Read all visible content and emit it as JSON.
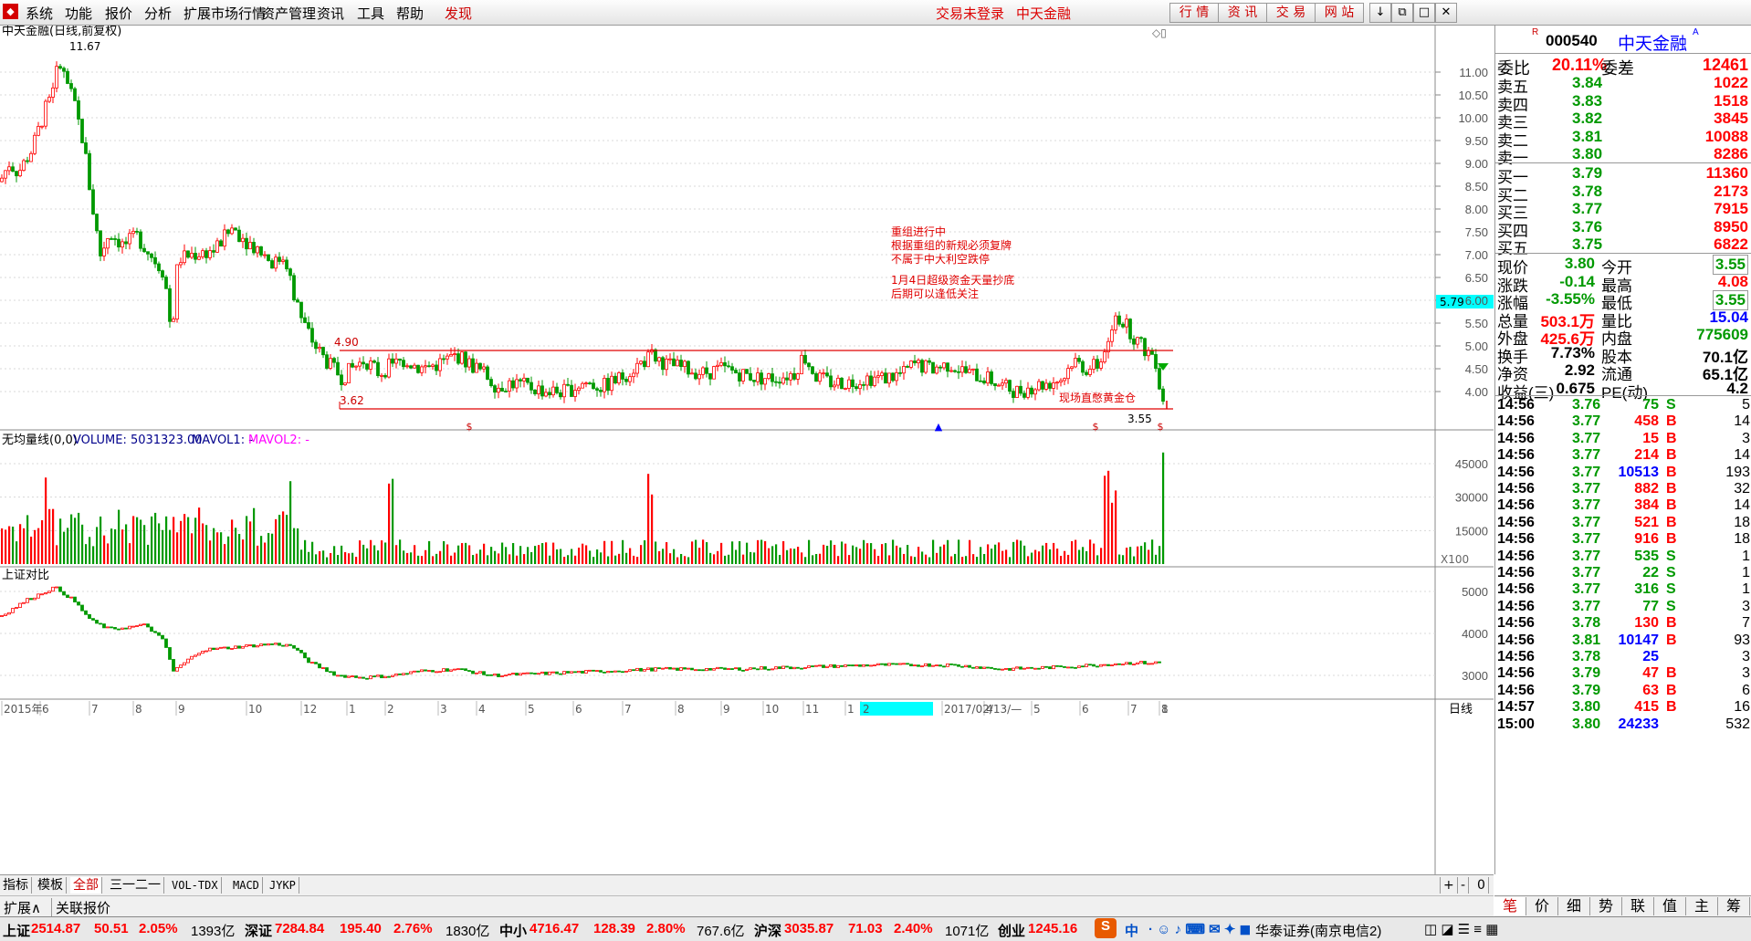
{
  "menu": [
    "系统",
    "功能",
    "报价",
    "分析",
    "扩展市场行情",
    "资产管理",
    "资讯",
    "工具",
    "帮助",
    "发现"
  ],
  "status_msg": "交易未登录",
  "status_app": "中天金融",
  "top_buttons": [
    "行 情",
    "资 讯",
    "交 易",
    "网 站"
  ],
  "window_buttons": [
    "↓",
    "⧉",
    "□",
    "✕"
  ],
  "chart": {
    "title": "中天金融(日线,前复权)",
    "max_label": "11.67",
    "price_ticks": [
      "11.00",
      "10.50",
      "10.00",
      "9.50",
      "9.00",
      "8.50",
      "8.00",
      "7.50",
      "7.00",
      "6.50",
      "6.00",
      "5.50",
      "5.00",
      "4.50",
      "4.00"
    ],
    "current_price_tag": "5.79",
    "line_490": "4.90",
    "line_362": "3.62",
    "min_label": "3.55",
    "annotation_lines": [
      "重组进行中",
      "根据重组的新规必须复牌",
      "不属于中大利空跌停",
      "1月4日超级资金天量抄底",
      "后期可以逢低关注"
    ],
    "note_bottom": "现场直憋黄金仓",
    "marker_dollar": "$",
    "marker_up": "▲",
    "volume_title": "无均量线(0,0)",
    "volume_label": "VOLUME: 5031323.00",
    "mavol1": "MAVOL1: -",
    "mavol2": "MAVOL2: -",
    "volume_ticks": [
      "45000",
      "30000",
      "15000"
    ],
    "volume_unit": "X100",
    "index_title": "上证对比",
    "index_ticks": [
      "5000",
      "4000",
      "3000"
    ],
    "date_labels": [
      "2015年",
      "6",
      "7",
      "8",
      "9",
      "10",
      "12",
      "1",
      "2",
      "3",
      "4",
      "5",
      "6",
      "7",
      "8",
      "9",
      "10",
      "11",
      "1",
      "2",
      "2017/02/13/—",
      "4",
      "5",
      "6",
      "7",
      "8",
      "1"
    ],
    "period": "日线"
  },
  "bottom_tabs": [
    "指标",
    "模板",
    "全部",
    "三一二一",
    "VOL-TDX",
    "MACD",
    "JYKP"
  ],
  "expand": [
    "扩展∧",
    "关联报价"
  ],
  "zoom_buttons": [
    "+",
    "-",
    "0"
  ],
  "quote": {
    "code": "000540",
    "name": "中天金融",
    "webi": {
      "label": "委比",
      "pct": "20.11%",
      "diff_label": "委差",
      "diff": "12461"
    },
    "asks": [
      {
        "label": "卖五",
        "price": "3.84",
        "vol": "1022"
      },
      {
        "label": "卖四",
        "price": "3.83",
        "vol": "1518"
      },
      {
        "label": "卖三",
        "price": "3.82",
        "vol": "3845"
      },
      {
        "label": "卖二",
        "price": "3.81",
        "vol": "10088"
      },
      {
        "label": "卖一",
        "price": "3.80",
        "vol": "8286"
      }
    ],
    "bids": [
      {
        "label": "买一",
        "price": "3.79",
        "vol": "11360"
      },
      {
        "label": "买二",
        "price": "3.78",
        "vol": "2173"
      },
      {
        "label": "买三",
        "price": "3.77",
        "vol": "7915"
      },
      {
        "label": "买四",
        "price": "3.76",
        "vol": "8950"
      },
      {
        "label": "买五",
        "price": "3.75",
        "vol": "6822"
      }
    ],
    "stats": [
      {
        "l1": "现价",
        "v1": "3.80",
        "c1": "grn",
        "l2": "今开",
        "v2": "3.55",
        "c2": "grn"
      },
      {
        "l1": "涨跌",
        "v1": "-0.14",
        "c1": "grn",
        "l2": "最高",
        "v2": "4.08",
        "c2": "red"
      },
      {
        "l1": "涨幅",
        "v1": "-3.55%",
        "c1": "grn",
        "l2": "最低",
        "v2": "3.55",
        "c2": "grn"
      },
      {
        "l1": "总量",
        "v1": "503.1万",
        "c1": "red",
        "l2": "量比",
        "v2": "15.04",
        "c2": "blu"
      },
      {
        "l1": "外盘",
        "v1": "425.6万",
        "c1": "red",
        "l2": "内盘",
        "v2": "775609",
        "c2": "grn"
      },
      {
        "l1": "换手",
        "v1": "7.73%",
        "c1": "blk",
        "l2": "股本",
        "v2": "70.1亿",
        "c2": "blk"
      },
      {
        "l1": "净资",
        "v1": "2.92",
        "c1": "blk",
        "l2": "流通",
        "v2": "65.1亿",
        "c2": "blk"
      },
      {
        "l1": "收益(三)",
        "v1": "0.675",
        "c1": "blk",
        "l2": "PE(动)",
        "v2": "4.2",
        "c2": "blk"
      }
    ],
    "ticks": [
      {
        "t": "14:56",
        "p": "3.76",
        "v": "75",
        "bs": "S",
        "n": "5"
      },
      {
        "t": "14:56",
        "p": "3.77",
        "v": "458",
        "bs": "B",
        "n": "14"
      },
      {
        "t": "14:56",
        "p": "3.77",
        "v": "15",
        "bs": "B",
        "n": "3"
      },
      {
        "t": "14:56",
        "p": "3.77",
        "v": "214",
        "bs": "B",
        "n": "14"
      },
      {
        "t": "14:56",
        "p": "3.77",
        "v": "10513",
        "bs": "B",
        "n": "193"
      },
      {
        "t": "14:56",
        "p": "3.77",
        "v": "882",
        "bs": "B",
        "n": "32"
      },
      {
        "t": "14:56",
        "p": "3.77",
        "v": "384",
        "bs": "B",
        "n": "14"
      },
      {
        "t": "14:56",
        "p": "3.77",
        "v": "521",
        "bs": "B",
        "n": "18"
      },
      {
        "t": "14:56",
        "p": "3.77",
        "v": "916",
        "bs": "B",
        "n": "18"
      },
      {
        "t": "14:56",
        "p": "3.77",
        "v": "535",
        "bs": "S",
        "n": "1"
      },
      {
        "t": "14:56",
        "p": "3.77",
        "v": "22",
        "bs": "S",
        "n": "1"
      },
      {
        "t": "14:56",
        "p": "3.77",
        "v": "316",
        "bs": "S",
        "n": "1"
      },
      {
        "t": "14:56",
        "p": "3.77",
        "v": "77",
        "bs": "S",
        "n": "3"
      },
      {
        "t": "14:56",
        "p": "3.78",
        "v": "130",
        "bs": "B",
        "n": "7"
      },
      {
        "t": "14:56",
        "p": "3.81",
        "v": "10147",
        "bs": "B",
        "n": "93"
      },
      {
        "t": "14:56",
        "p": "3.78",
        "v": "25",
        "bs": "",
        "n": "3"
      },
      {
        "t": "14:56",
        "p": "3.79",
        "v": "47",
        "bs": "B",
        "n": "3"
      },
      {
        "t": "14:56",
        "p": "3.79",
        "v": "63",
        "bs": "B",
        "n": "6"
      },
      {
        "t": "14:57",
        "p": "3.80",
        "v": "415",
        "bs": "B",
        "n": "16"
      },
      {
        "t": "15:00",
        "p": "3.80",
        "v": "24233",
        "bs": "",
        "n": "532"
      }
    ],
    "tabs": [
      "笔",
      "价",
      "细",
      "势",
      "联",
      "值",
      "主",
      "筹"
    ]
  },
  "statusbar": {
    "sh_label": "上证",
    "sh": "2514.87",
    "sh_chg": "50.51",
    "sh_pct": "2.05%",
    "sh_amt": "1393亿",
    "sz_label": "深证",
    "sz": "7284.84",
    "sz_chg": "195.40",
    "sz_pct": "2.76%",
    "sz_amt": "1830亿",
    "zx_label": "中小",
    "zx": "4716.47",
    "zx_chg": "128.39",
    "zx_pct": "2.80%",
    "zx_amt": "767.6亿",
    "hs_label": "沪深",
    "hs": "3035.87",
    "hs_chg": "71.03",
    "hs_pct": "2.40%",
    "hs_amt": "1071亿",
    "cy_label": "创业",
    "cy": "1245.16",
    "broker": "华泰证券(南京电信2)",
    "ime": "中"
  },
  "colors": {
    "up": "#ff0000",
    "down": "#009900",
    "accent": "#00ffff",
    "axis": "#c0c0c0"
  }
}
